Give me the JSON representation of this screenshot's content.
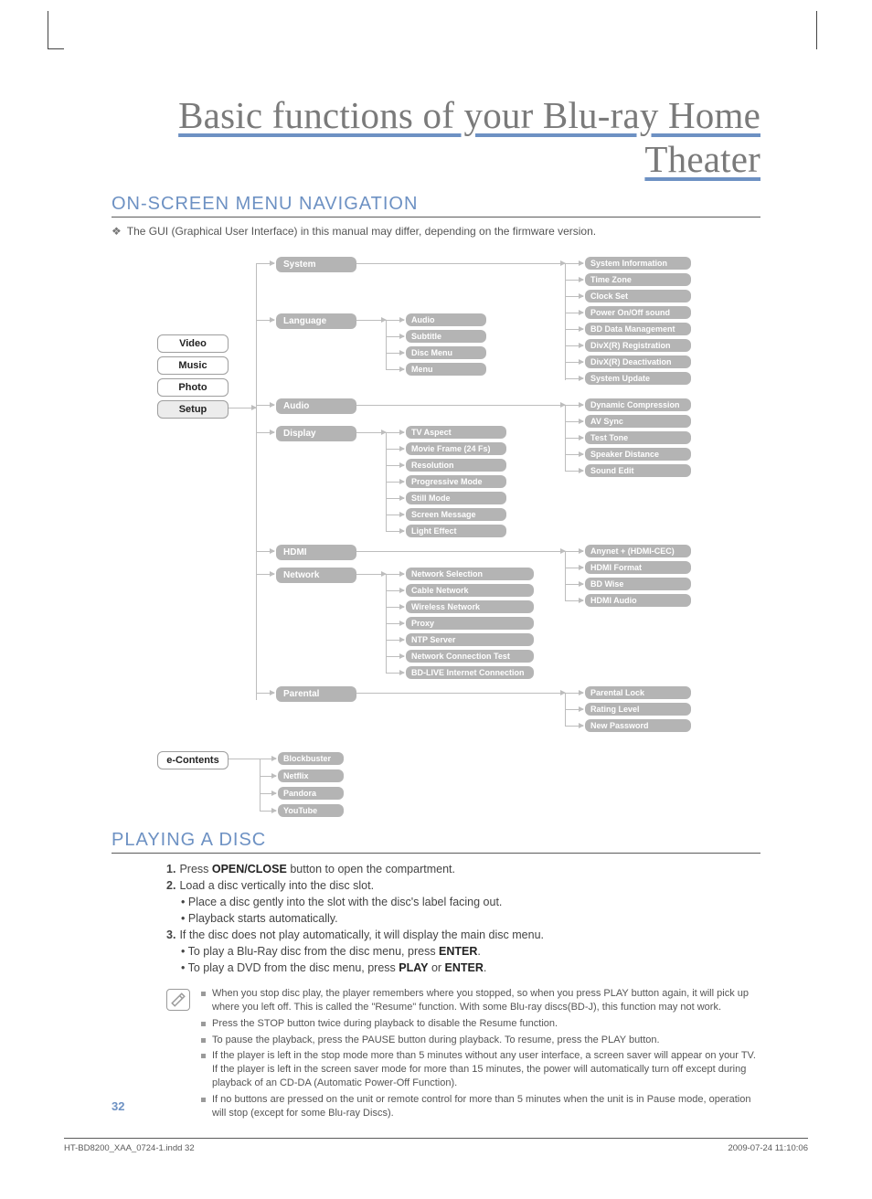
{
  "title": "Basic functions of your Blu-ray Home Theater",
  "section1": "ON-SCREEN MENU NAVIGATION",
  "gui_note": "The GUI (Graphical User Interface) in this manual may differ, depending on the firmware version.",
  "left_menu": {
    "video": "Video",
    "music": "Music",
    "photo": "Photo",
    "setup": "Setup",
    "econtents": "e-Contents"
  },
  "setup_branches": {
    "system": "System",
    "language": "Language",
    "audio": "Audio",
    "display": "Display",
    "hdmi": "HDMI",
    "network": "Network",
    "parental": "Parental"
  },
  "language_sub": {
    "audio": "Audio",
    "subtitle": "Subtitle",
    "discmenu": "Disc Menu",
    "menu": "Menu"
  },
  "display_sub": {
    "tvaspect": "TV Aspect",
    "movieframe": "Movie Frame (24 Fs)",
    "resolution": "Resolution",
    "progressive": "Progressive Mode",
    "stillmode": "Still Mode",
    "screenmsg": "Screen Message",
    "lighteffect": "Light Effect"
  },
  "network_sub": {
    "selection": "Network Selection",
    "cable": "Cable Network",
    "wireless": "Wireless Network",
    "proxy": "Proxy",
    "ntp": "NTP Server",
    "conntest": "Network Connection Test",
    "bdlive": "BD-LIVE Internet Connection"
  },
  "system_right": {
    "sysinfo": "System Information",
    "timezone": "Time Zone",
    "clockset": "Clock Set",
    "poweronoff": "Power On/Off sound",
    "bddata": "BD Data Management",
    "divxreg": "DivX(R) Registration",
    "divxdeact": "DivX(R) Deactivation",
    "sysupdate": "System Update"
  },
  "audio_right": {
    "dyncomp": "Dynamic Compression",
    "avsync": "AV Sync",
    "testtone": "Test Tone",
    "speakerdist": "Speaker Distance",
    "soundedit": "Sound Edit"
  },
  "hdmi_right": {
    "anynet": "Anynet + (HDMI-CEC)",
    "hdmiformat": "HDMI Format",
    "bdwise": "BD Wise",
    "hdmiaudio": "HDMI Audio"
  },
  "parental_right": {
    "lock": "Parental Lock",
    "rating": "Rating Level",
    "newpass": "New Password"
  },
  "econtents_sub": {
    "blockbuster": "Blockbuster",
    "netflix": "Netflix",
    "pandora": "Pandora",
    "youtube": "YouTube"
  },
  "section2": "PLAYING A DISC",
  "steps": {
    "s1a": "Press ",
    "s1b": "OPEN/CLOSE",
    "s1c": " button to open the compartment.",
    "s2": "Load a disc vertically into the disc slot.",
    "s2a": "Place a disc gently into the slot with the disc's label facing out.",
    "s2b": "Playback starts automatically.",
    "s3": "If the disc does not play automatically, it will display the main disc menu.",
    "s3a_a": "To play a Blu-Ray disc from the disc menu, press ",
    "s3a_b": "ENTER",
    "s3a_c": ".",
    "s3b_a": "To play a DVD from the disc menu, press ",
    "s3b_b": "PLAY",
    "s3b_c": " or ",
    "s3b_d": "ENTER",
    "s3b_e": "."
  },
  "notes": {
    "n1": "When you stop disc play, the player remembers where you stopped, so when you press PLAY button again, it will pick up where you left off. This is called the \"Resume\" function. With some Blu-ray discs(BD-J), this function may not work.",
    "n2": "Press the STOP button twice during playback to disable the Resume function.",
    "n3": "To pause the playback, press the PAUSE button during playback. To resume, press the PLAY button.",
    "n4": "If the player is left in the stop mode more than 5 minutes without any user interface, a screen saver will appear on your TV. If the player is left in the screen saver mode for more than 15 minutes, the power will automatically turn off except during playback of an CD-DA (Automatic Power-Off Function).",
    "n5": "If no buttons are pressed on the unit or remote control for more than 5 minutes when the unit is in Pause mode, operation will stop (except for some Blu-ray Discs)."
  },
  "page_num": "32",
  "footer_left": "HT-BD8200_XAA_0724-1.indd   32",
  "footer_right": "2009-07-24   11:10:06"
}
